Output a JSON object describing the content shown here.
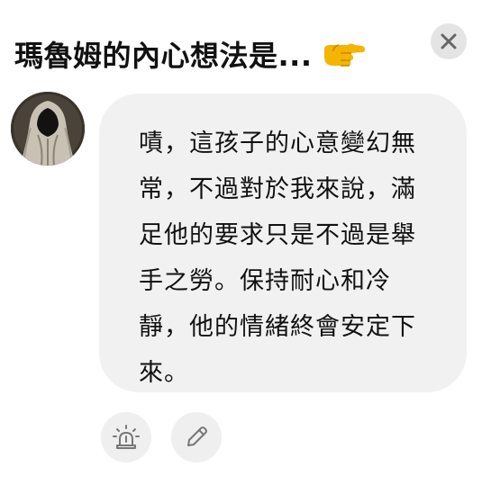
{
  "header": {
    "title": "瑪魯姆的內心想法是...",
    "pointer_icon": "backhand-index-pointing-right-icon",
    "close_icon": "close-icon"
  },
  "message": {
    "avatar": "hooded-figure-avatar",
    "text": "嘖，這孩子的心意變幻無常，不過對於我來說，滿足他的要求只是不過是舉手之勞。保持耐心和冷靜，他的情緒終會安定下來。"
  },
  "actions": {
    "report_icon": "alarm-light-icon",
    "edit_icon": "pencil-icon"
  },
  "colors": {
    "bubble": "#f1f1f1",
    "button_bg": "#efefef",
    "icon_gray": "#777777",
    "pointer_yellow": "#f4b400"
  }
}
